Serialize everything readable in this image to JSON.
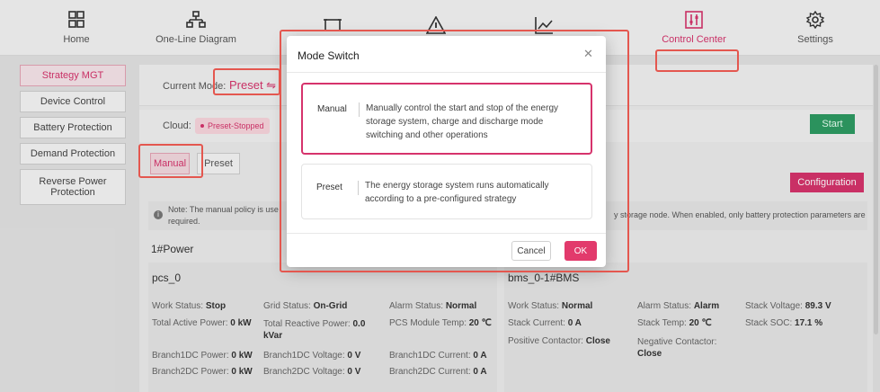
{
  "nav": {
    "items": [
      {
        "label": "Home",
        "icon": "grid-icon"
      },
      {
        "label": "One-Line Diagram",
        "icon": "diagram-icon"
      },
      {
        "label": "",
        "icon": "battery-frame-icon"
      },
      {
        "label": "",
        "icon": "warning-icon"
      },
      {
        "label": "",
        "icon": "chart-line-icon"
      },
      {
        "label": "Control Center",
        "icon": "control-icon"
      },
      {
        "label": "Settings",
        "icon": "gear-icon"
      }
    ],
    "active_color": "#d6336c"
  },
  "sidebar": {
    "items": [
      {
        "label": "Strategy MGT"
      },
      {
        "label": "Device Control"
      },
      {
        "label": "Battery Protection"
      },
      {
        "label": "Demand Protection"
      },
      {
        "label": "Reverse Power Protection"
      }
    ]
  },
  "main": {
    "current_mode_label": "Current Mode:",
    "current_mode_value": "Preset ⇋",
    "cloud_label": "Cloud:",
    "cloud_status": "Preset-Stopped",
    "start_label": "Start",
    "tabs": [
      {
        "label": "Manual"
      },
      {
        "label": "Preset"
      }
    ],
    "configuration_label": "Configuration",
    "note_line1": "Note: The manual policy is use",
    "note_line2": "required.",
    "note_tail": "y storage node. When enabled, only battery protection parameters are",
    "power_title": "1#Power",
    "pcs": {
      "title": "pcs_0",
      "fields": [
        {
          "k": "Work Status:",
          "v": "Stop"
        },
        {
          "k": "Grid Status:",
          "v": "On-Grid"
        },
        {
          "k": "Alarm Status:",
          "v": "Normal"
        },
        {
          "k": "Total Active Power:",
          "v": "0 kW"
        },
        {
          "k": "Total Reactive Power:",
          "v": "0.0 kVar"
        },
        {
          "k": "PCS Module Temp:",
          "v": "20 ℃"
        },
        {
          "k": "Branch1DC Power:",
          "v": "0 kW"
        },
        {
          "k": "Branch1DC Voltage:",
          "v": "0 V"
        },
        {
          "k": "Branch1DC Current:",
          "v": "0 A"
        },
        {
          "k": "Branch2DC Power:",
          "v": "0 kW"
        },
        {
          "k": "Branch2DC Voltage:",
          "v": "0 V"
        },
        {
          "k": "Branch2DC Current:",
          "v": "0 A"
        }
      ]
    },
    "bms": {
      "title": "bms_0-1#BMS",
      "fields": [
        {
          "k": "Work Status:",
          "v": "Normal"
        },
        {
          "k": "Alarm Status:",
          "v": "Alarm"
        },
        {
          "k": "Stack Voltage:",
          "v": "89.3 V"
        },
        {
          "k": "Stack Current:",
          "v": "0 A"
        },
        {
          "k": "Stack Temp:",
          "v": "20 ℃"
        },
        {
          "k": "Stack SOC:",
          "v": "17.1 %"
        },
        {
          "k": "Positive Contactor:",
          "v": "Close"
        },
        {
          "k": "Negative Contactor:",
          "v": "Close"
        }
      ]
    }
  },
  "modal": {
    "title": "Mode Switch",
    "close_icon": "close-icon",
    "options": [
      {
        "name": "Manual",
        "desc": "Manually control the start and stop of the energy storage system, charge and discharge mode switching and other operations"
      },
      {
        "name": "Preset",
        "desc": "The energy storage system runs automatically according to a pre-configured strategy"
      }
    ],
    "cancel_label": "Cancel",
    "ok_label": "OK"
  }
}
